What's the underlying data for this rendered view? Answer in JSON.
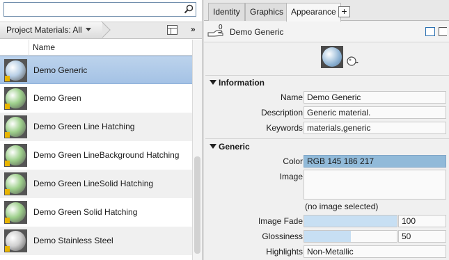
{
  "search": {
    "value": "",
    "placeholder": ""
  },
  "filter": {
    "label": "Project Materials: All",
    "more": "»"
  },
  "list": {
    "column_name": "Name",
    "items": [
      {
        "label": "Demo Generic",
        "ball_color": "#b9d0e6",
        "selected": true
      },
      {
        "label": "Demo Green",
        "ball_color": "#9ed08c",
        "selected": false
      },
      {
        "label": "Demo Green Line Hatching",
        "ball_color": "#9ed08c",
        "selected": false
      },
      {
        "label": "Demo Green LineBackground Hatching",
        "ball_color": "#9ed08c",
        "selected": false
      },
      {
        "label": "Demo Green LineSolid Hatching",
        "ball_color": "#9ed08c",
        "selected": false
      },
      {
        "label": "Demo Green Solid Hatching",
        "ball_color": "#9ed08c",
        "selected": false
      },
      {
        "label": "Demo Stainless Steel",
        "ball_color": "#cfcfcf",
        "selected": false
      }
    ]
  },
  "tabs": [
    {
      "label": "Identity",
      "active": false
    },
    {
      "label": "Graphics",
      "active": false
    },
    {
      "label": "Appearance",
      "active": true
    }
  ],
  "add_tab_label": "+",
  "asset": {
    "count": "0",
    "title": "Demo Generic"
  },
  "sections": {
    "information": "Information",
    "generic": "Generic"
  },
  "properties": {
    "name_label": "Name",
    "name_value": "Demo Generic",
    "description_label": "Description",
    "description_value": "Generic material.",
    "keywords_label": "Keywords",
    "keywords_value": "materials,generic",
    "color_label": "Color",
    "color_value": "RGB 145 186 217",
    "color_hex": "#91bad9",
    "image_label": "Image",
    "image_note": "(no image selected)",
    "image_fade_label": "Image Fade",
    "image_fade_value": "100",
    "image_fade_fraction": 1.0,
    "glossiness_label": "Glossiness",
    "glossiness_value": "50",
    "glossiness_fraction": 0.5,
    "highlights_label": "Highlights",
    "highlights_value": "Non-Metallic"
  },
  "colors": {
    "selection": "#a4c2e5",
    "accent_bar": "#c7dff3",
    "warning_badge": "#e8b400"
  }
}
